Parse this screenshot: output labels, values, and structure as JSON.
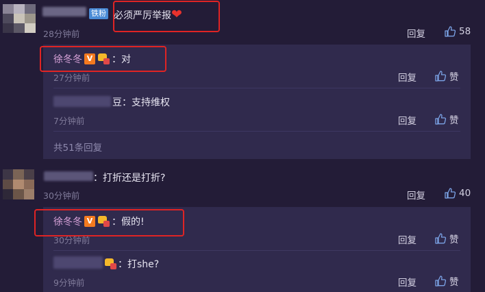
{
  "comments": [
    {
      "badge": "铁粉",
      "text": "必须严厉举报",
      "time": "28分钟前",
      "reply_label": "回复",
      "likes": "58",
      "replies": [
        {
          "user": "徐冬冬",
          "text": "对",
          "time": "27分钟前",
          "reply_label": "回复",
          "like_label": "赞"
        },
        {
          "user_suffix": "豆",
          "text": "支持维权",
          "time": "7分钟前",
          "reply_label": "回复",
          "like_label": "赞"
        }
      ],
      "more_replies": "共51条回复"
    },
    {
      "text": "打折还是打折?",
      "time": "30分钟前",
      "reply_label": "回复",
      "likes": "40",
      "replies": [
        {
          "user": "徐冬冬",
          "text": "假的!",
          "time": "30分钟前",
          "reply_label": "回复",
          "like_label": "赞"
        },
        {
          "text": "打she?",
          "time": "9分钟前",
          "reply_label": "回复",
          "like_label": "赞"
        }
      ]
    }
  ],
  "colors": {
    "background": "#231c37",
    "reply_panel": "#302a4d",
    "highlight_box": "#e02424",
    "vip_name": "#d7a2d8",
    "verified_badge": "#f47a1f",
    "fan_badge": "#4a8bd6"
  }
}
